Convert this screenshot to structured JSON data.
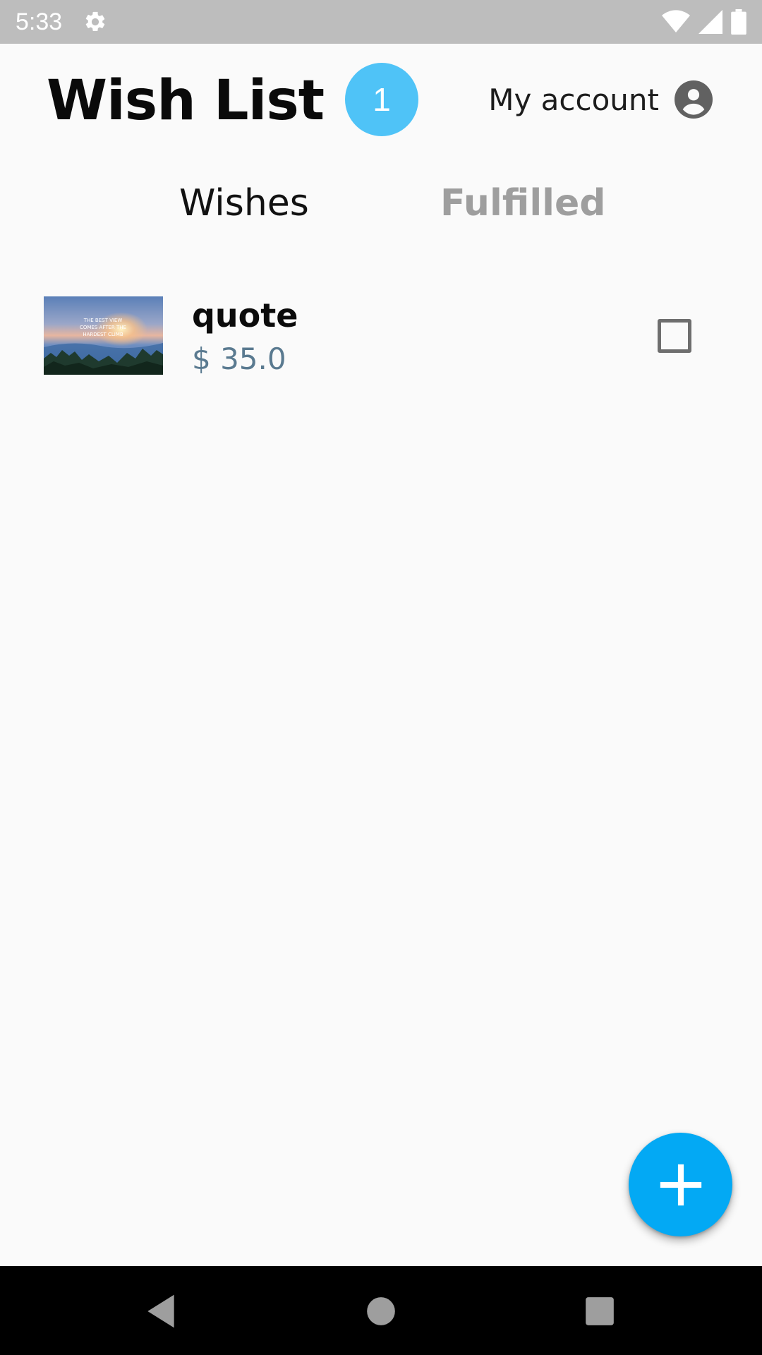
{
  "status_bar": {
    "time": "5:33",
    "icons": [
      "gear-icon",
      "wifi-icon",
      "signal-icon",
      "battery-icon"
    ]
  },
  "header": {
    "title": "Wish List",
    "badge_count": "1",
    "account_label": "My account",
    "account_icon": "account-circle-icon"
  },
  "tabs": [
    {
      "label": "Wishes",
      "active": true
    },
    {
      "label": "Fulfilled",
      "active": false
    }
  ],
  "wishes": [
    {
      "name": "quote",
      "price": "$ 35.0",
      "image_text": [
        "THE BEST VIEW",
        "COMES AFTER THE",
        "HARDEST CLIMB"
      ],
      "fulfilled": false
    }
  ],
  "fab": {
    "icon": "plus-icon"
  },
  "nav_bar": {
    "icons": [
      "back-icon",
      "home-icon",
      "recents-icon"
    ]
  },
  "colors": {
    "status_bar": "#bdbdbd",
    "badge": "#4fc3f7",
    "fab": "#03a9f4",
    "price": "#5a7a90",
    "inactive_tab": "#9e9e9e"
  }
}
